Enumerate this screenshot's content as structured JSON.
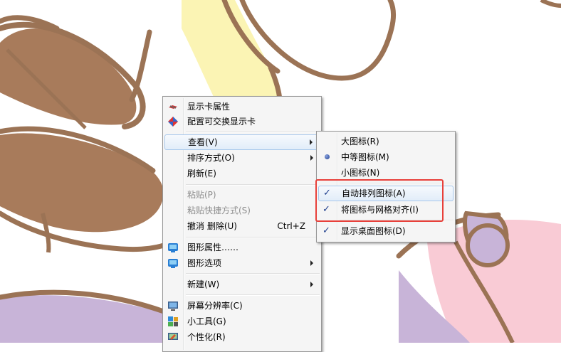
{
  "context_menu": {
    "items": [
      {
        "label": "显示卡属性",
        "icon": "graphics-card-icon"
      },
      {
        "label": "配置可交换显示卡",
        "icon": "switchable-graphics-icon"
      },
      {
        "label": "查看(V)",
        "has_submenu": true,
        "highlighted": true
      },
      {
        "label": "排序方式(O)",
        "has_submenu": true
      },
      {
        "label": "刷新(E)"
      },
      {
        "label": "粘贴(P)",
        "disabled": true
      },
      {
        "label": "粘贴快捷方式(S)",
        "disabled": true
      },
      {
        "label": "撤消 删除(U)",
        "shortcut": "Ctrl+Z"
      },
      {
        "label": "图形属性……",
        "icon": "intel-graphics-icon"
      },
      {
        "label": "图形选项",
        "icon": "intel-graphics-icon",
        "has_submenu": true
      },
      {
        "label": "新建(W)",
        "has_submenu": true
      },
      {
        "label": "屏幕分辨率(C)",
        "icon": "screen-resolution-icon"
      },
      {
        "label": "小工具(G)",
        "icon": "gadgets-icon"
      },
      {
        "label": "个性化(R)",
        "icon": "personalize-icon"
      }
    ]
  },
  "view_submenu": {
    "items": [
      {
        "label": "大图标(R)"
      },
      {
        "label": "中等图标(M)",
        "radio_selected": true
      },
      {
        "label": "小图标(N)"
      },
      {
        "label": "自动排列图标(A)",
        "checked": true,
        "highlighted": true
      },
      {
        "label": "将图标与网格对齐(I)",
        "checked": true
      },
      {
        "label": "显示桌面图标(D)",
        "checked": true
      }
    ]
  },
  "colors": {
    "menu_background": "#f5f5f5",
    "highlight": "#dfeaf8",
    "annotation": "#e8403a",
    "check": "#1f3f8e"
  }
}
